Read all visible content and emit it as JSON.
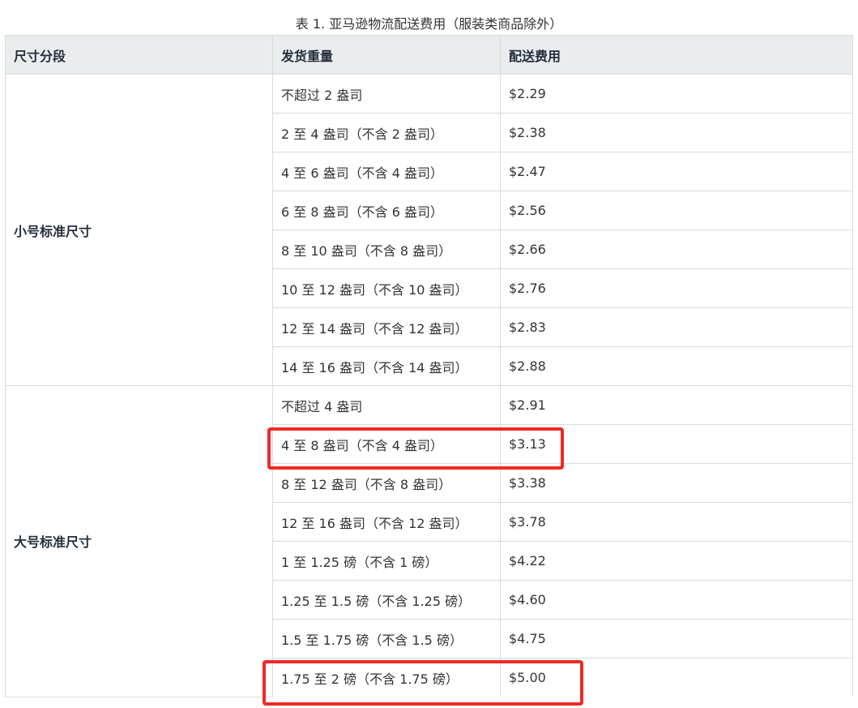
{
  "caption": "表 1. 亚马逊物流配送费用（服装类商品除外）",
  "table": {
    "headers": [
      "尺寸分段",
      "发货重量",
      "配送费用"
    ],
    "groups": [
      {
        "tier": "小号标准尺寸",
        "rows": [
          {
            "weight": "不超过 2 盎司",
            "fee": "$2.29"
          },
          {
            "weight": "2 至 4 盎司（不含 2 盎司）",
            "fee": "$2.38"
          },
          {
            "weight": "4 至 6 盎司（不含 4 盎司）",
            "fee": "$2.47"
          },
          {
            "weight": "6 至 8 盎司（不含 6 盎司）",
            "fee": "$2.56"
          },
          {
            "weight": "8 至 10 盎司（不含 8 盎司）",
            "fee": "$2.66"
          },
          {
            "weight": "10 至 12 盎司（不含 10 盎司）",
            "fee": "$2.76"
          },
          {
            "weight": "12 至 14 盎司（不含 12 盎司）",
            "fee": "$2.83"
          },
          {
            "weight": "14 至 16 盎司（不含 14 盎司）",
            "fee": "$2.88"
          }
        ]
      },
      {
        "tier": "大号标准尺寸",
        "rows": [
          {
            "weight": "不超过 4 盎司",
            "fee": "$2.91"
          },
          {
            "weight": "4 至 8 盎司（不含 4 盎司）",
            "fee": "$3.13"
          },
          {
            "weight": "8 至 12 盎司（不含 8 盎司）",
            "fee": "$3.38"
          },
          {
            "weight": "12 至 16 盎司（不含 12 盎司）",
            "fee": "$3.78"
          },
          {
            "weight": "1 至 1.25 磅（不含 1 磅）",
            "fee": "$4.22"
          },
          {
            "weight": "1.25 至 1.5 磅（不含 1.25 磅）",
            "fee": "$4.60"
          },
          {
            "weight": "1.5 至 1.75 磅（不含 1.5 磅）",
            "fee": "$4.75"
          },
          {
            "weight": "1.75 至 2 磅（不含 1.75 磅）",
            "fee": "$5.00"
          }
        ]
      }
    ]
  },
  "highlight_color": "#ee2a24"
}
